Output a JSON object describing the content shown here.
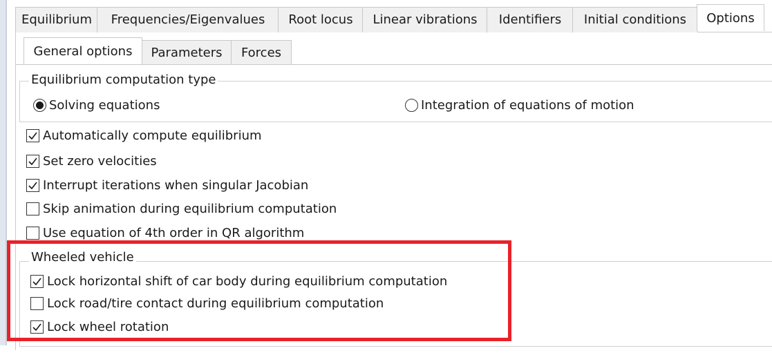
{
  "top_tabs": [
    "Equilibrium",
    "Frequencies/Eigenvalues",
    "Root locus",
    "Linear vibrations",
    "Identifiers",
    "Initial conditions",
    "Options"
  ],
  "active_top_tab": "Options",
  "inner_tabs": [
    "General options",
    "Parameters",
    "Forces"
  ],
  "active_inner_tab": "General options",
  "equilibrium_type": {
    "title": "Equilibrium computation type",
    "options": [
      {
        "label": "Solving equations",
        "selected": true
      },
      {
        "label": "Integration of equations of motion",
        "selected": false
      }
    ]
  },
  "general_checkboxes": [
    {
      "label": "Automatically compute equilibrium",
      "checked": true
    },
    {
      "label": "Set zero velocities",
      "checked": true
    },
    {
      "label": "Interrupt iterations when singular Jacobian",
      "checked": true
    },
    {
      "label": "Skip animation during equilibrium computation",
      "checked": false
    },
    {
      "label": "Use equation of 4th order in QR algorithm",
      "checked": false
    }
  ],
  "wheeled_vehicle": {
    "title": "Wheeled vehicle",
    "checkboxes": [
      {
        "label": "Lock horizontal shift of car body during equilibrium computation",
        "checked": true
      },
      {
        "label": "Lock road/tire contact during equilibrium computation",
        "checked": false
      },
      {
        "label": "Lock wheel rotation",
        "checked": true
      }
    ]
  },
  "colors": {
    "highlight": "#e8222a",
    "border": "#c9c9c9",
    "tab_bg": "#f0f0f0"
  }
}
